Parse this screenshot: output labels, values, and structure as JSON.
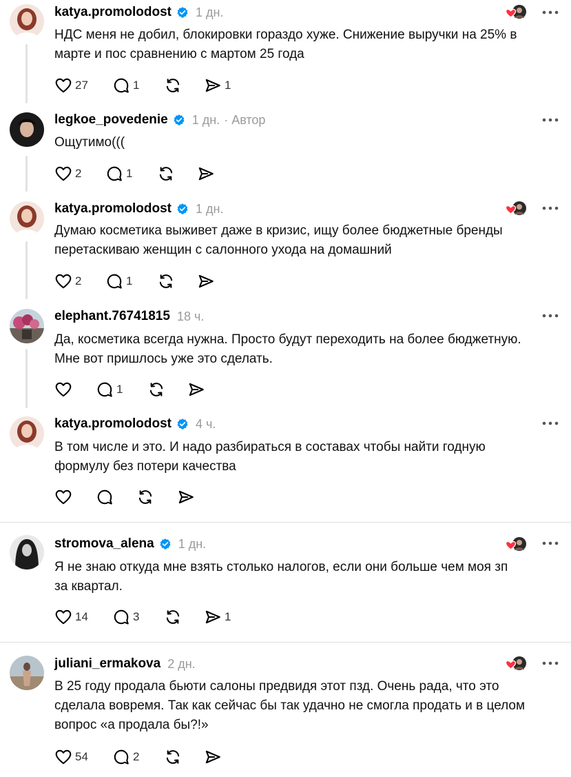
{
  "posts": [
    {
      "username": "katya.promolodost",
      "verified": true,
      "time": "1 дн.",
      "author_label": "",
      "lines": [
        "НДС меня не добил, блокировки гораздо хуже. Снижение выручки на 25% в",
        "марте и пос сравнению с мартом 25 года"
      ],
      "likes": "27",
      "replies": "1",
      "reposts": "",
      "shares": "1",
      "author_liked": true
    },
    {
      "username": "legkoe_povedenie",
      "verified": true,
      "time": "1 дн.",
      "author_label": "· Автор",
      "lines": [
        "Ощутимо((("
      ],
      "likes": "2",
      "replies": "1",
      "reposts": "",
      "shares": "",
      "author_liked": false
    },
    {
      "username": "katya.promolodost",
      "verified": true,
      "time": "1 дн.",
      "author_label": "",
      "lines": [
        "Думаю косметика выживет даже в кризис, ищу более бюджетные бренды",
        "перетаскиваю женщин с салонного ухода на домашний"
      ],
      "likes": "2",
      "replies": "1",
      "reposts": "",
      "shares": "",
      "author_liked": true
    },
    {
      "username": "elephant.76741815",
      "verified": false,
      "time": "18 ч.",
      "author_label": "",
      "lines": [
        "Да, косметика всегда нужна. Просто будут переходить на более бюджетную.",
        "Мне вот пришлось уже это сделать."
      ],
      "likes": "",
      "replies": "1",
      "reposts": "",
      "shares": "",
      "author_liked": false
    },
    {
      "username": "katya.promolodost",
      "verified": true,
      "time": "4 ч.",
      "author_label": "",
      "lines": [
        "В том числе и это. И надо разбираться в составах чтобы найти годную",
        "формулу без потери качества"
      ],
      "likes": "",
      "replies": "",
      "reposts": "",
      "shares": "",
      "author_liked": false
    },
    {
      "username": "stromova_alena",
      "verified": true,
      "time": "1 дн.",
      "author_label": "",
      "lines": [
        "Я не знаю откуда мне взять столько налогов, если они больше чем моя зп",
        "за квартал."
      ],
      "likes": "14",
      "replies": "3",
      "reposts": "",
      "shares": "1",
      "author_liked": true
    },
    {
      "username": "juliani_ermakova",
      "verified": false,
      "time": "2 дн.",
      "author_label": "",
      "lines": [
        "В 25 году продала бьюти салоны предвидя этот пзд. Очень рада, что это",
        "сделала вовремя. Так как сейчас бы так удачно не смогла продать и в целом",
        "вопрос «а продала бы?!»"
      ],
      "likes": "54",
      "replies": "2",
      "reposts": "",
      "shares": "",
      "author_liked": true
    }
  ],
  "colors": {
    "verified": "#0095f6",
    "heart": "#ff3040",
    "muted": "#9a9a9a",
    "divider": "#dedede"
  },
  "icons": [
    "heart-icon",
    "reply-icon",
    "repost-icon",
    "share-icon",
    "more-icon",
    "verified-badge-icon",
    "liked-by-author-icon"
  ]
}
